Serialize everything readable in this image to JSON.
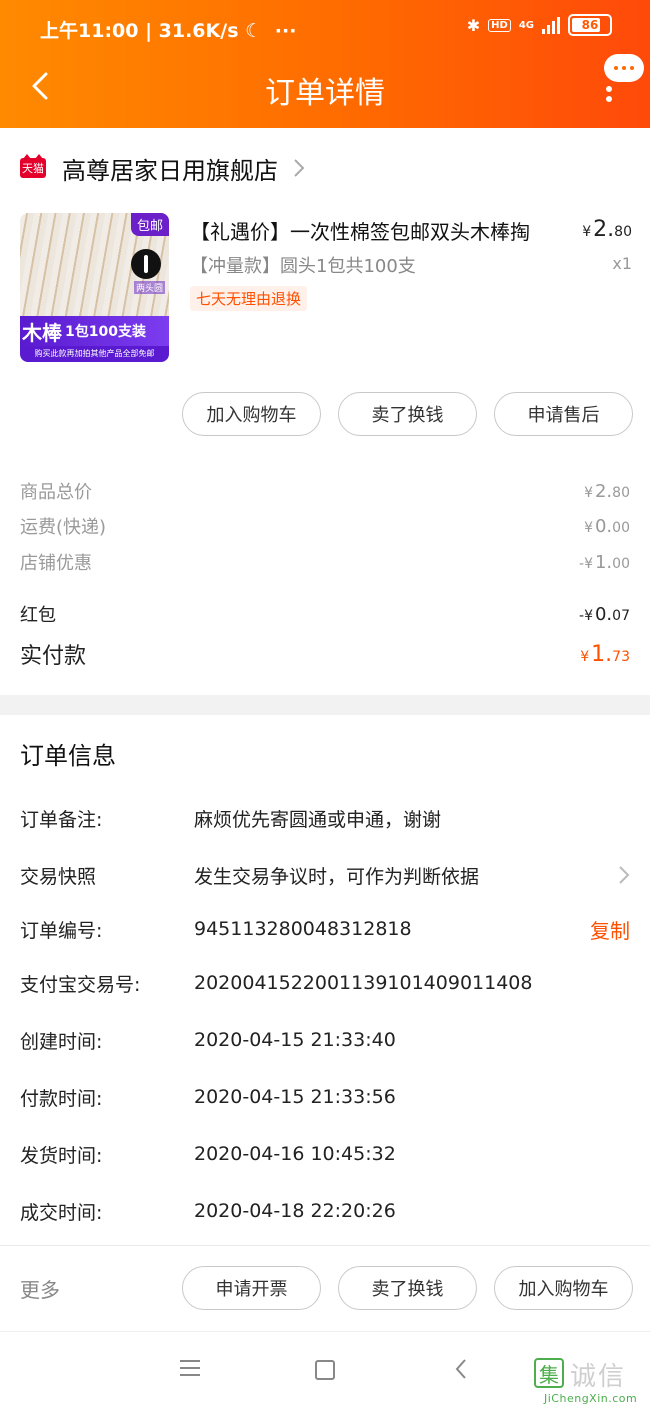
{
  "status_bar": {
    "time": "上午11:00 | 31.6K/s",
    "moon": "☾",
    "more": "···",
    "bluetooth": "✱",
    "hd": "HD",
    "network": "4G",
    "battery": "86",
    "battery_level": 0.86
  },
  "header": {
    "title": "订单详情"
  },
  "store": {
    "badge": "天猫",
    "name": "高尊居家日用旗舰店"
  },
  "product": {
    "title": "【礼遇价】一次性棉签包邮双头木棒掏",
    "sku": "【冲量款】圆头1包共100支",
    "tag": "七天无理由退换",
    "price_symbol": "¥",
    "price_int": "2.",
    "price_dec": "80",
    "qty": "x1",
    "image": {
      "badge": "包邮",
      "swab_label": "两头圆",
      "banner_big": "木棒",
      "banner_small": "1包100支装",
      "footer": "购买此款再加拍其他产品全部免邮"
    }
  },
  "product_actions": {
    "add_cart": "加入购物车",
    "resell": "卖了换钱",
    "after_sale": "申请售后"
  },
  "price_summary": {
    "items": [
      {
        "label": "商品总价",
        "prefix": "¥",
        "int": "2.",
        "dec": "80"
      },
      {
        "label": "运费(快递)",
        "prefix": "¥",
        "int": "0.",
        "dec": "00"
      },
      {
        "label": "店铺优惠",
        "prefix": "-¥",
        "int": "1.",
        "dec": "00"
      },
      {
        "label": "红包",
        "prefix": "-¥",
        "int": "0.",
        "dec": "07"
      },
      {
        "label": "实付款",
        "prefix": "¥",
        "int": "1.",
        "dec": "73"
      }
    ]
  },
  "order_info": {
    "title": "订单信息",
    "rows": [
      {
        "label": "订单备注:",
        "value": "麻烦优先寄圆通或申通，谢谢"
      },
      {
        "label": "交易快照",
        "value": "发生交易争议时，可作为判断依据"
      },
      {
        "label": "订单编号:",
        "value": "945113280048312818",
        "action": "复制"
      },
      {
        "label": "支付宝交易号:",
        "value": "2020041522001139101409011408"
      },
      {
        "label": "创建时间:",
        "value": "2020-04-15 21:33:40"
      },
      {
        "label": "付款时间:",
        "value": "2020-04-15 21:33:56"
      },
      {
        "label": "发货时间:",
        "value": "2020-04-16 10:45:32"
      },
      {
        "label": "成交时间:",
        "value": "2020-04-18 22:20:26"
      }
    ]
  },
  "bottom_bar": {
    "more": "更多",
    "invoice": "申请开票",
    "resell": "卖了换钱",
    "add_cart": "加入购物车"
  },
  "watermark": {
    "logo": "集",
    "text": "诚信",
    "url": "JiChengXin.com"
  },
  "colors": {
    "header_start": "#ff8a00",
    "header_end": "#ff4a0a",
    "accent": "#ff5000"
  }
}
